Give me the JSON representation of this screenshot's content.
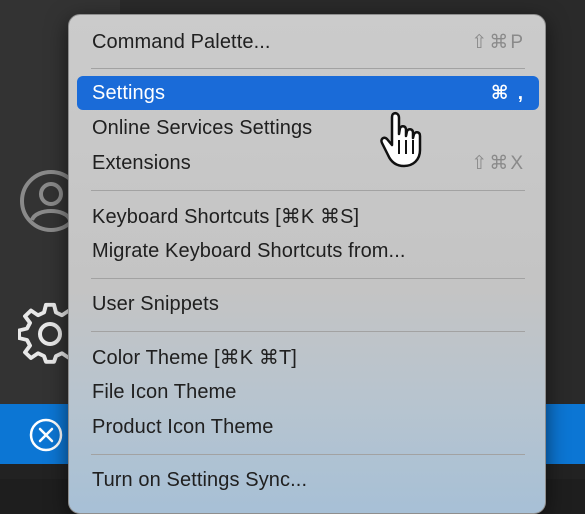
{
  "menu": {
    "items": [
      {
        "label": "Command Palette...",
        "shortcut": "⇧⌘P"
      },
      {
        "label": "Settings",
        "shortcut": "⌘ ,",
        "selected": true
      },
      {
        "label": "Online Services Settings",
        "shortcut": ""
      },
      {
        "label": "Extensions",
        "shortcut": "⇧⌘X"
      },
      {
        "label": "Keyboard Shortcuts [⌘K ⌘S]",
        "shortcut": ""
      },
      {
        "label": "Migrate Keyboard Shortcuts from...",
        "shortcut": ""
      },
      {
        "label": "User Snippets",
        "shortcut": ""
      },
      {
        "label": "Color Theme [⌘K ⌘T]",
        "shortcut": ""
      },
      {
        "label": "File Icon Theme",
        "shortcut": ""
      },
      {
        "label": "Product Icon Theme",
        "shortcut": ""
      },
      {
        "label": "Turn on Settings Sync...",
        "shortcut": ""
      }
    ]
  },
  "colors": {
    "selection": "#1a6bd8",
    "status_bar": "#0c76d4",
    "activity_bar": "#333333"
  },
  "icons": {
    "account": "account-icon",
    "manage": "gear-icon",
    "status": "error-circle-icon",
    "pointer": "hand-pointer-icon"
  }
}
